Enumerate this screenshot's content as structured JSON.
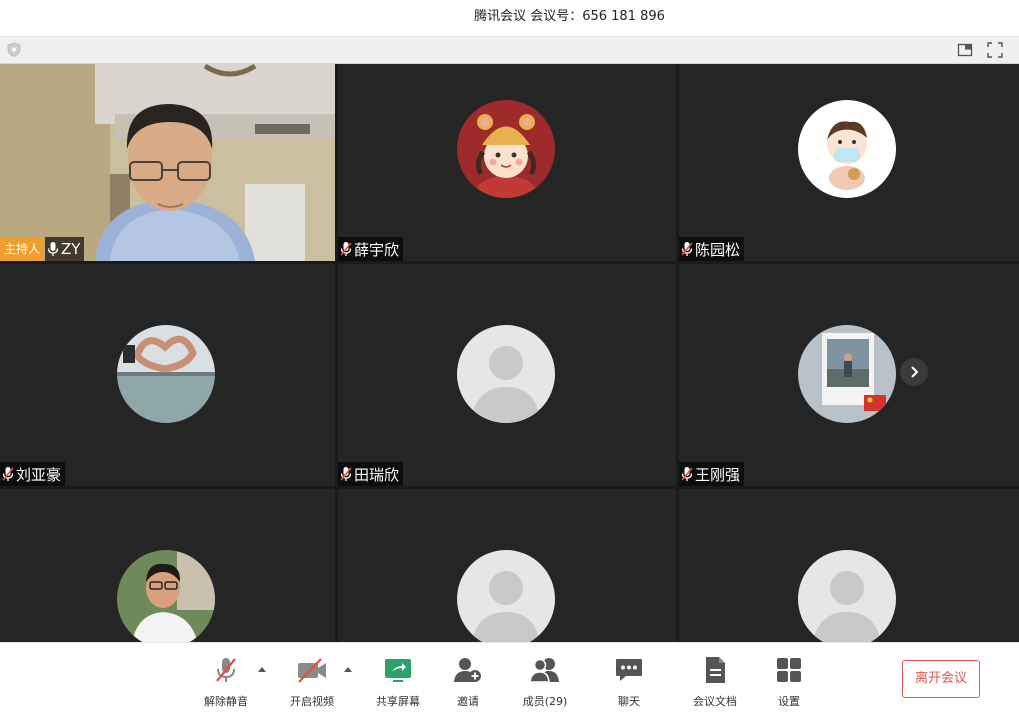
{
  "title_bar": {
    "title": "腾讯会议 会议号：656 181 896"
  },
  "tiles": [
    {
      "name": "ZY",
      "host_badge": "主持人"
    },
    {
      "name": "薛宇欣"
    },
    {
      "name": "陈园松"
    },
    {
      "name": "刘亚豪"
    },
    {
      "name": "田瑞欣"
    },
    {
      "name": "王刚强"
    },
    {
      "name": ""
    },
    {
      "name": ""
    },
    {
      "name": ""
    }
  ],
  "toolbar": {
    "mute_label": "解除静音",
    "video_label": "开启视频",
    "share_label": "共享屏幕",
    "invite_label": "邀请",
    "members_label": "成员(29)",
    "chat_label": "聊天",
    "docs_label": "会议文档",
    "settings_label": "设置",
    "leave_label": "离开会议"
  },
  "colors": {
    "host_badge": "#f0a02a",
    "leave_button": "#e05555",
    "share_icon": "#2aa36b",
    "tile_background": "#252525"
  }
}
